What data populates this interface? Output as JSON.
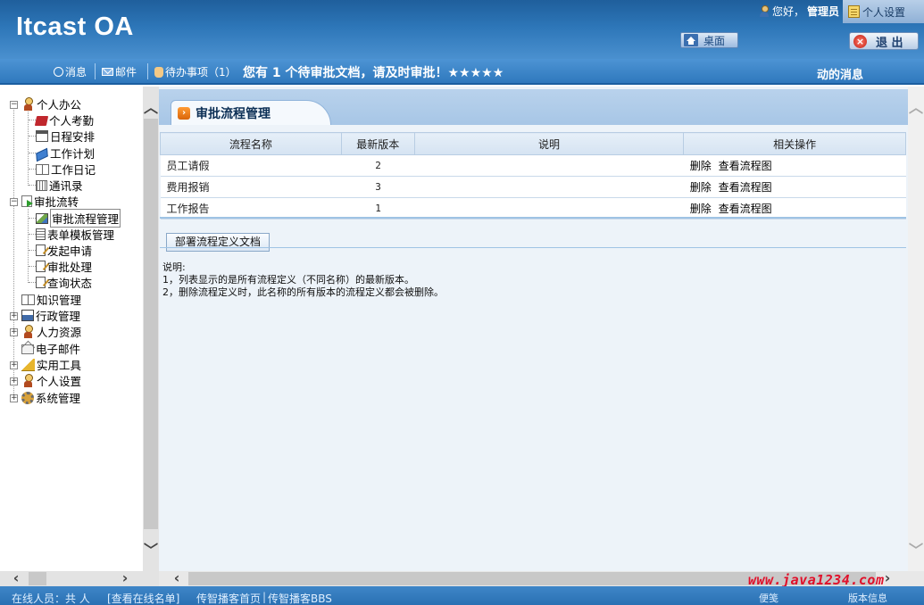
{
  "header": {
    "logo": "Itcast OA",
    "greeting": "您好，",
    "user_name": "管理员",
    "settings_label": "个人设置",
    "desktop_label": "桌面",
    "logout_label": "退 出"
  },
  "navbar": {
    "messages_label": "消息",
    "mail_label": "邮件",
    "todo_label": "待办事项（1）",
    "alert_text": "您有 1 个待审批文档，请及时审批！★★★★★",
    "moving_text": "动的消息"
  },
  "sidebar": {
    "tree": [
      {
        "label": "个人办公",
        "level": 0,
        "expanded": true,
        "icon": "person-icon"
      },
      {
        "label": "个人考勤",
        "level": 1,
        "icon": "book-icon"
      },
      {
        "label": "日程安排",
        "level": 1,
        "icon": "calendar-icon"
      },
      {
        "label": "工作计划",
        "level": 1,
        "icon": "plan-icon"
      },
      {
        "label": "工作日记",
        "level": 1,
        "icon": "open-book-icon"
      },
      {
        "label": "通讯录",
        "level": 1,
        "icon": "address-book-icon"
      },
      {
        "label": "审批流转",
        "level": 0,
        "expanded": true,
        "icon": "flow-icon"
      },
      {
        "label": "审批流程管理",
        "level": 1,
        "selected": true,
        "icon": "picture-icon"
      },
      {
        "label": "表单模板管理",
        "level": 1,
        "icon": "document-icon"
      },
      {
        "label": "发起申请",
        "level": 1,
        "icon": "edit-icon"
      },
      {
        "label": "审批处理",
        "level": 1,
        "icon": "edit-icon"
      },
      {
        "label": "查询状态",
        "level": 1,
        "icon": "edit-icon"
      },
      {
        "label": "知识管理",
        "level": 0,
        "icon": "open-book-icon"
      },
      {
        "label": "行政管理",
        "level": 0,
        "collapsed": true,
        "icon": "admin-icon"
      },
      {
        "label": "人力资源",
        "level": 0,
        "collapsed": true,
        "icon": "person-icon"
      },
      {
        "label": "电子邮件",
        "level": 0,
        "icon": "envelope-icon"
      },
      {
        "label": "实用工具",
        "level": 0,
        "collapsed": true,
        "icon": "ruler-icon"
      },
      {
        "label": "个人设置",
        "level": 0,
        "collapsed": true,
        "icon": "person-icon"
      },
      {
        "label": "系统管理",
        "level": 0,
        "collapsed": true,
        "icon": "gear-icon"
      }
    ]
  },
  "main": {
    "title": "审批流程管理",
    "table": {
      "headers": [
        "流程名称",
        "最新版本",
        "说明",
        "相关操作"
      ],
      "rows": [
        {
          "name": "员工请假",
          "version": "2",
          "description": "",
          "op_delete": "删除",
          "op_view": "查看流程图"
        },
        {
          "name": "费用报销",
          "version": "3",
          "description": "",
          "op_delete": "删除",
          "op_view": "查看流程图"
        },
        {
          "name": "工作报告",
          "version": "1",
          "description": "",
          "op_delete": "删除",
          "op_view": "查看流程图"
        }
      ]
    },
    "deploy_button": "部署流程定义文档",
    "notes": [
      "说明:",
      "1，列表显示的是所有流程定义（不同名称）的最新版本。",
      "2，删除流程定义时，此名称的所有版本的流程定义都会被删除。"
    ]
  },
  "footer": {
    "online_label": "在线人员：共 人",
    "view_online": "[查看在线名单]",
    "home_link": "传智播客首页",
    "bbs_link": "传智播客BBS",
    "notes_label": "便笺",
    "version_label": "版本信息",
    "watermark": "www.java1234.com"
  },
  "colors": {
    "header_blue": "#2d76b8",
    "nav_blue": "#3f86c8",
    "watermark_red": "#e0102a"
  }
}
